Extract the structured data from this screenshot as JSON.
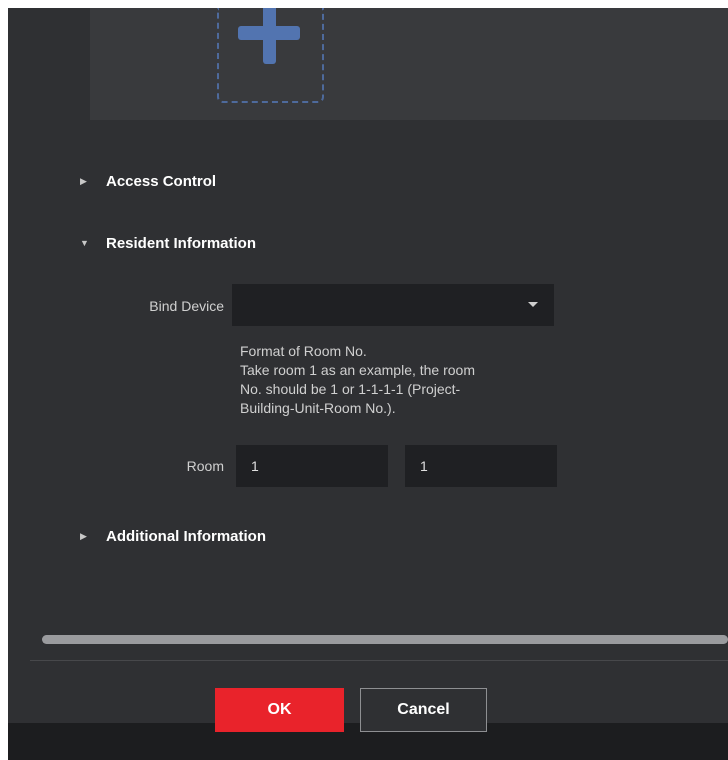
{
  "sections": {
    "access_control": {
      "title": "Access Control",
      "arrow": "▶"
    },
    "resident_information": {
      "title": "Resident Information",
      "arrow": "▼"
    },
    "additional_information": {
      "title": "Additional Information",
      "arrow": "▶"
    }
  },
  "bind_device": {
    "label": "Bind Device",
    "value": ""
  },
  "room_hint": [
    "Format of Room No.",
    "Take room 1 as an example, the room",
    "No. should be 1 or 1-1-1-1 (Project-",
    "Building-Unit-Room No.)."
  ],
  "room": {
    "label": "Room",
    "value1": "1",
    "value2": "1"
  },
  "buttons": {
    "ok": "OK",
    "cancel": "Cancel"
  },
  "colors": {
    "primary": "#e9232b",
    "background": "#2f3033",
    "input_bg": "#1f2023",
    "accent_blue": "#5274b0"
  }
}
